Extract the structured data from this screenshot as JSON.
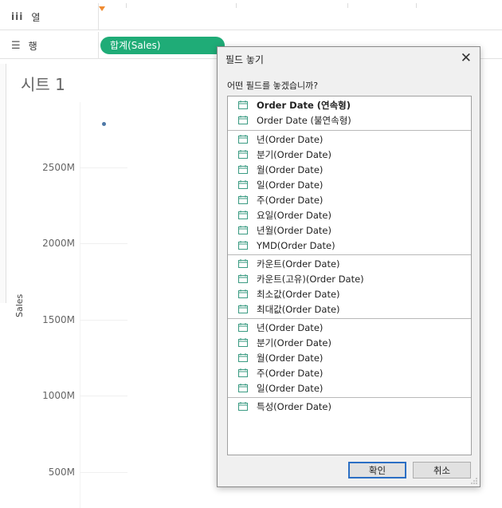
{
  "shelves": {
    "columns": {
      "icon": "columns-icon",
      "label": "열"
    },
    "rows": {
      "icon": "rows-icon",
      "label": "행",
      "pill": "합계(Sales)",
      "pill_color": "#1fac77"
    }
  },
  "sheet": {
    "title": "시트 1",
    "axis_title": "Sales",
    "ticks": [
      "2500M",
      "2000M",
      "1500M",
      "1000M",
      "500M"
    ],
    "mark_color": "#4e79a7"
  },
  "dialog": {
    "title": "필드 놓기",
    "prompt": "어떤 필드를 놓겠습니까?",
    "items": [
      "Order Date (연속형)",
      "Order Date (불연속형)",
      "년(Order Date)",
      "분기(Order Date)",
      "월(Order Date)",
      "일(Order Date)",
      "주(Order Date)",
      "요일(Order Date)",
      "년월(Order Date)",
      "YMD(Order Date)",
      "카운트(Order Date)",
      "카운트(고유)(Order Date)",
      "최소값(Order Date)",
      "최대값(Order Date)",
      "년(Order Date)",
      "분기(Order Date)",
      "월(Order Date)",
      "주(Order Date)",
      "일(Order Date)",
      "특성(Order Date)"
    ],
    "item_icon": "calendar-icon",
    "ok_label": "확인",
    "cancel_label": "취소",
    "accent_color": "#2b6fc4"
  }
}
